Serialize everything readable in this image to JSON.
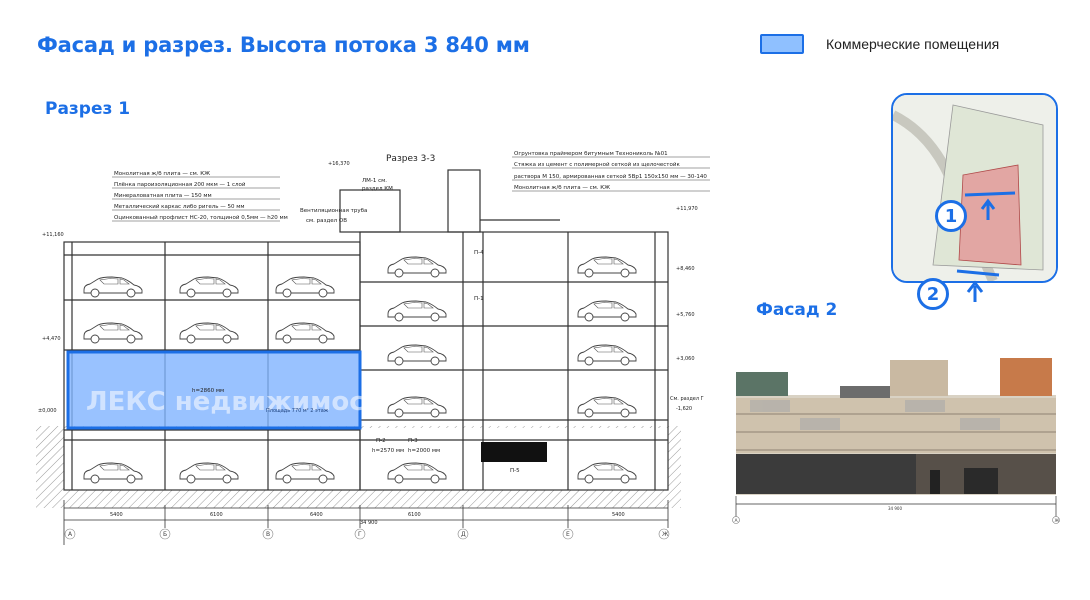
{
  "page": {
    "title": "Фасад и разрез. Высота потока 3 840 мм",
    "legend": {
      "label": "Коммерческие помещения",
      "swatch_color": "#8fc0ff",
      "border_color": "#1c6fe6"
    },
    "section_title": "Разрез 1",
    "facade_title": "Фасад 2",
    "markers": [
      "1",
      "2"
    ],
    "accent_color": "#1c6fe6"
  },
  "section": {
    "top_label": "Разрез 3-3",
    "roof_notes": [
      "Монолитная ж/б плита — см. КЖ",
      "Плёнка пароизоляционная 200 мкм — 1 слой",
      "Минераловатная плита — 150 мм",
      "Металлический каркас либо ригель — 50 мм",
      "Оцинкованный профлист НС-20, толщиной 0,5мм — h20 мм"
    ],
    "right_notes": [
      "Огрунтовка праймером битумным Технониколь №01",
      "Стяжка из цемент с полимерной сеткой из щелочестойк",
      "раствора М 150, армированная сеткой 5Вр1 150x150 мм — 30-140",
      "Монолитная ж/б плита — см. КЖ"
    ],
    "vent_label": "Вентиляционная труба",
    "vent_ref": "см. раздел ОВ",
    "lift_label": "ЛМ-1 см.",
    "lift_ref": "раздел КМ",
    "elevations": [
      "+16,370",
      "+11,970",
      "+11,160",
      "+8,460",
      "+5,760",
      "+4,470",
      "+3,060",
      "±0,000",
      "-1,620"
    ],
    "dimensions": [
      "5400",
      "6100",
      "6400",
      "6100",
      "5400"
    ],
    "total_dimension": "34 900",
    "axes": [
      "А",
      "Б",
      "В",
      "Г",
      "Д",
      "Е",
      "Ж"
    ],
    "room_labels": [
      "П-2",
      "П-3",
      "П-4",
      "П-5",
      "П-1"
    ],
    "heights": [
      "h=2570 мм",
      "h=2000 мм",
      "h=2860 мм"
    ],
    "watermark": "ЛЕКС недвижимость",
    "commercial_note": "Площадь 770 м² 2 этаж",
    "right_ref": "См. раздел Г"
  },
  "facade": {
    "axes": [
      "А",
      "Ж"
    ],
    "dimension": "34 900"
  },
  "colors": {
    "commercial_fill": "#7fb3ff",
    "commercial_stroke": "#1c6fe6",
    "drawing_line": "#333333",
    "hatch": "#8a8a8a",
    "facade_dark": "#3b3b3b",
    "facade_beige": "#c9b9a2",
    "facade_green": "#5b7466",
    "facade_orange": "#c77a4a"
  }
}
